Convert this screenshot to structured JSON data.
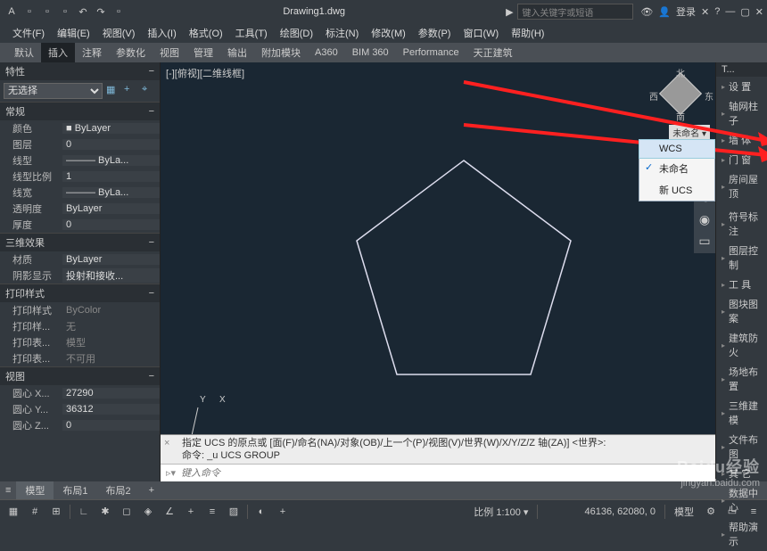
{
  "title_bar": {
    "doc_name": "Drawing1.dwg",
    "search_placeholder": "键入关键字或短语",
    "login_label": "登录"
  },
  "menu": [
    "文件(F)",
    "编辑(E)",
    "视图(V)",
    "插入(I)",
    "格式(O)",
    "工具(T)",
    "绘图(D)",
    "标注(N)",
    "修改(M)",
    "参数(P)",
    "窗口(W)",
    "帮助(H)"
  ],
  "ribbon_tabs": [
    "默认",
    "插入",
    "注释",
    "参数化",
    "视图",
    "管理",
    "输出",
    "附加模块",
    "A360",
    "BIM 360",
    "Performance",
    "天正建筑"
  ],
  "ribbon_active": 1,
  "properties": {
    "title": "特性",
    "selection": "无选择",
    "sections": [
      {
        "title": "常规",
        "rows": [
          {
            "k": "颜色",
            "v": "■ ByLayer"
          },
          {
            "k": "图层",
            "v": "0"
          },
          {
            "k": "线型",
            "v": "——— ByLa..."
          },
          {
            "k": "线型比例",
            "v": "1"
          },
          {
            "k": "线宽",
            "v": "——— ByLa..."
          },
          {
            "k": "透明度",
            "v": "ByLayer"
          },
          {
            "k": "厚度",
            "v": "0"
          }
        ]
      },
      {
        "title": "三维效果",
        "rows": [
          {
            "k": "材质",
            "v": "ByLayer"
          },
          {
            "k": "阴影显示",
            "v": "投射和接收..."
          }
        ]
      },
      {
        "title": "打印样式",
        "rows": [
          {
            "k": "打印样式",
            "v": "ByColor",
            "dis": true
          },
          {
            "k": "打印样...",
            "v": "无",
            "dis": true
          },
          {
            "k": "打印表...",
            "v": "模型",
            "dis": true
          },
          {
            "k": "打印表...",
            "v": "不可用",
            "dis": true
          }
        ]
      },
      {
        "title": "视图",
        "rows": [
          {
            "k": "圆心 X...",
            "v": "27290"
          },
          {
            "k": "圆心 Y...",
            "v": "36312"
          },
          {
            "k": "圆心 Z...",
            "v": "0"
          }
        ]
      }
    ]
  },
  "canvas": {
    "view_label": "[-][俯视][二维线框]",
    "viewcube": {
      "n": "北",
      "s": "南",
      "e": "东",
      "w": "西"
    },
    "ucs_tag": "未命名 ▾",
    "ucs_menu": [
      {
        "label": "WCS",
        "selected": true,
        "checked": false
      },
      {
        "label": "未命名",
        "selected": false,
        "checked": true
      },
      {
        "label": "新 UCS",
        "selected": false,
        "checked": false
      }
    ],
    "axis_x": "X",
    "axis_y": "Y"
  },
  "command": {
    "history1": "指定 UCS 的原点或 [面(F)/命名(NA)/对象(OB)/上一个(P)/视图(V)/世界(W)/X/Y/Z/Z 轴(ZA)] <世界>:",
    "history2": "命令: _u UCS GROUP",
    "prompt": "▹▾",
    "placeholder": "键入命令"
  },
  "tool_palette": {
    "title": "T...",
    "items": [
      "设  置",
      "轴网柱子",
      "墙  体",
      "门  窗",
      "房间屋顶",
      "",
      "符号标注",
      "图层控制",
      "工  具",
      "图块图案",
      "建筑防火",
      "场地布置",
      "三维建模",
      "文件布图",
      "其  它",
      "数据中心",
      "帮助演示"
    ]
  },
  "layout_tabs": [
    "模型",
    "布局1",
    "布局2"
  ],
  "status": {
    "scale": "比例 1:100 ▾",
    "coords": "46136, 62080, 0",
    "space": "模型"
  },
  "watermark": {
    "brand": "Baidu经验",
    "url": "jingyan.baidu.com"
  }
}
